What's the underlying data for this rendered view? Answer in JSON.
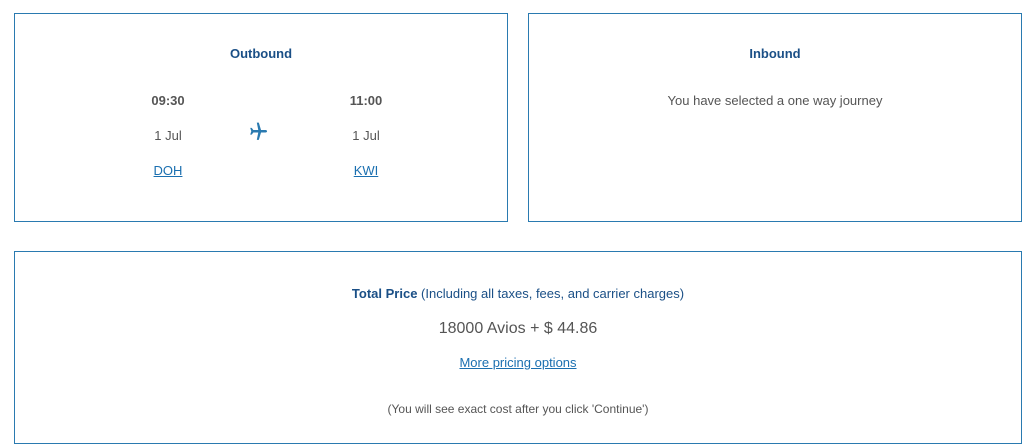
{
  "outbound": {
    "title": "Outbound",
    "departure": {
      "time": "09:30",
      "date": "1 Jul",
      "airport": "DOH"
    },
    "arrival": {
      "time": "11:00",
      "date": "1 Jul",
      "airport": "KWI"
    },
    "icon": "airplane-icon"
  },
  "inbound": {
    "title": "Inbound",
    "message": "You have selected a one way journey"
  },
  "price": {
    "label": "Total Price",
    "note": " (Including all taxes, fees, and carrier charges)",
    "amount": "18000 Avios + $ 44.86",
    "more_link": "More pricing options",
    "footnote": "(You will see exact cost after you click 'Continue')"
  },
  "colors": {
    "border": "#2a7ab0",
    "heading": "#1a4f86",
    "link": "#1a6fb0",
    "text": "#555555"
  }
}
